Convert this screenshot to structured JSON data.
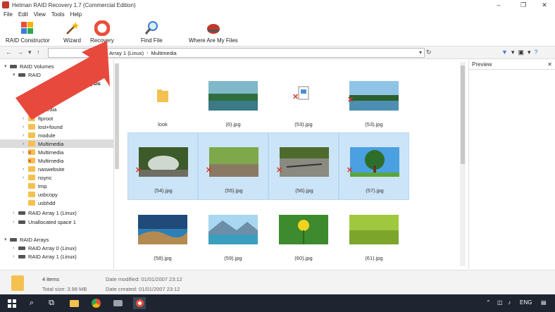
{
  "window": {
    "title": "Hetman RAID Recovery 1.7 (Commercial Edition)",
    "minimize": "–",
    "maximize": "❐",
    "close": "✕"
  },
  "menu": [
    "File",
    "Edit",
    "View",
    "Tools",
    "Help"
  ],
  "toolbar": {
    "raid_constructor": "RAID Constructor",
    "wizard": "Wizard",
    "recovery": "Recovery",
    "find_file": "Find File",
    "where_are_my_files": "Where Are My Files"
  },
  "address": {
    "path": [
      "RAID Array 1 (Linux)",
      "Multimedia"
    ]
  },
  "tree": {
    "raid_volumes": "RAID Volumes",
    "raid_top_truncated": "RAID",
    "analysis_fragment": "alysis",
    "media_fragment": "media",
    "items": [
      {
        "label": "ftproot",
        "deleted": false
      },
      {
        "label": "lost+found",
        "deleted": false
      },
      {
        "label": "module",
        "deleted": false
      },
      {
        "label": "Multimedia",
        "deleted": false,
        "selected": true
      },
      {
        "label": "Multimedia",
        "deleted": true
      },
      {
        "label": "Multimedia",
        "deleted": true
      },
      {
        "label": "naswebsite",
        "deleted": false
      },
      {
        "label": "nsync",
        "deleted": false
      },
      {
        "label": "tmp",
        "deleted": false
      },
      {
        "label": "usbcopy",
        "deleted": false
      },
      {
        "label": "usbhdd",
        "deleted": false
      }
    ],
    "raid_array_1": "RAID Array 1 (Linux)",
    "unallocated": "Unallocated space 1",
    "raid_arrays": "RAID Arrays",
    "array0": "RAID Array 0 (Linux)",
    "array1": "RAID Array 1 (Linux)"
  },
  "files": [
    {
      "name": "look",
      "kind": "folder"
    },
    {
      "name": "(6).jpg",
      "kind": "lake",
      "deleted": false
    },
    {
      "name": "(53).jpg",
      "kind": "doc",
      "deleted": true
    },
    {
      "name": "(53).jpg",
      "kind": "lake2",
      "deleted": true
    },
    {
      "name": "(54).jpg",
      "kind": "tree_tunnel",
      "deleted": true,
      "selected": true
    },
    {
      "name": "(55).jpg",
      "kind": "grass",
      "deleted": true,
      "selected": true
    },
    {
      "name": "(56).jpg",
      "kind": "rock",
      "deleted": true,
      "selected": true
    },
    {
      "name": "(57).jpg",
      "kind": "tree",
      "deleted": true,
      "selected": true
    },
    {
      "name": "(58).jpg",
      "kind": "coast",
      "deleted": false
    },
    {
      "name": "(59).jpg",
      "kind": "mountain_lake",
      "deleted": false
    },
    {
      "name": "(60).jpg",
      "kind": "flower",
      "deleted": false
    },
    {
      "name": "(61).jpg",
      "kind": "meadow",
      "deleted": false
    }
  ],
  "preview": {
    "title": "Preview",
    "close": "✕"
  },
  "status": {
    "items": "4 items",
    "total_size": "Total size: 3.98 MB",
    "date_modified": "Date modified: 01/01/2007 23:12",
    "date_created": "Date created: 01/01/2007 23:12"
  },
  "taskbar": {
    "language": "ENG"
  },
  "colors": {
    "accent": "#cce4f7",
    "arrow": "#e8493d",
    "deleted": "#d13a2a",
    "taskbar": "#1e2430"
  }
}
